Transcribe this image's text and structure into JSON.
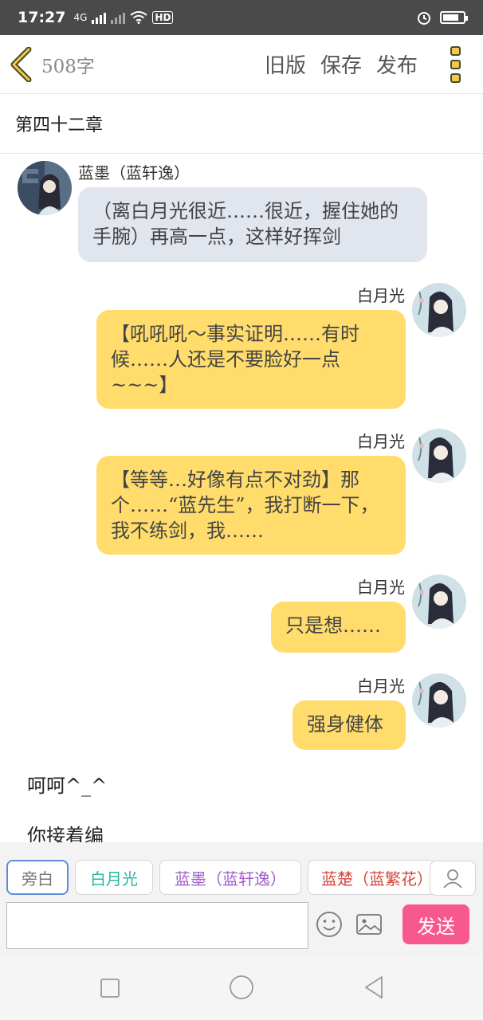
{
  "status_bar": {
    "time": "17:27",
    "network_1": "4G",
    "network_2": "HD",
    "battery_level": 0.8
  },
  "header": {
    "word_count": "508字",
    "actions": [
      "旧版",
      "保存",
      "发布"
    ]
  },
  "chapter_title": "第四十二章",
  "messages": [
    {
      "side": "left",
      "sender": "蓝墨（蓝轩逸）",
      "text": "（离白月光很近……很近，握住她的手腕）再高一点，这样好挥剑"
    },
    {
      "side": "right",
      "sender": "白月光",
      "text": "【吼吼吼～事实证明……有时候……人还是不要脸好一点~~~】"
    },
    {
      "side": "right",
      "sender": "白月光",
      "text": "【等等…好像有点不对劲】那个……“蓝先生”，我打断一下，我不练剑，我……"
    },
    {
      "side": "right",
      "sender": "白月光",
      "text": "只是想……"
    },
    {
      "side": "right",
      "sender": "白月光",
      "text": "强身健体"
    }
  ],
  "narration": [
    "呵呵^_^",
    "你接着编"
  ],
  "composer": {
    "roles": [
      {
        "label": "旁白",
        "color": "#777777",
        "active": true
      },
      {
        "label": "白月光",
        "color": "#2ab5a7",
        "active": false
      },
      {
        "label": "蓝墨（蓝轩逸）",
        "color": "#a05cc8",
        "active": false
      },
      {
        "label": "蓝楚（蓝繁花）",
        "color": "#d8433a",
        "active": false
      }
    ],
    "input_value": "",
    "send_label": "发送"
  },
  "colors": {
    "left_bubble": "#e1e6ee",
    "right_bubble": "#ffdc6b",
    "send": "#f7598e",
    "status_bar": "#4a4a4a"
  }
}
